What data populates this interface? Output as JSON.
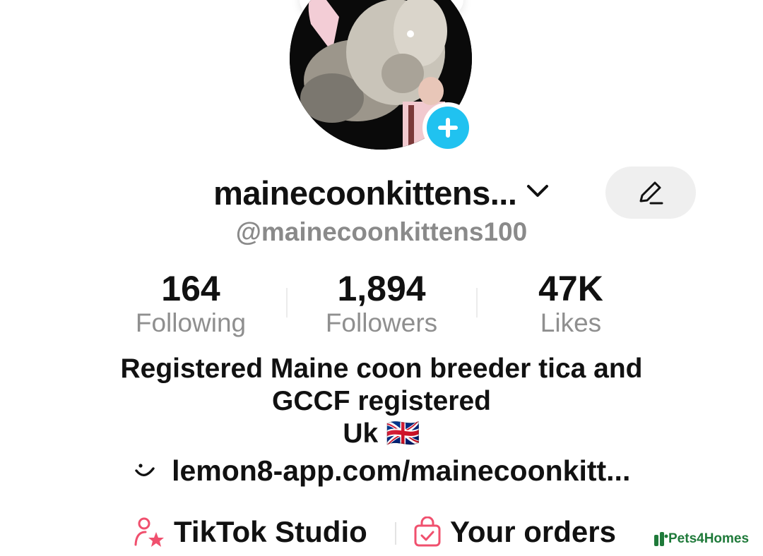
{
  "profile": {
    "display_name": "mainecoonkittens...",
    "handle": "@mainecoonkittens100"
  },
  "stats": {
    "following": {
      "value": "164",
      "label": "Following"
    },
    "followers": {
      "value": "1,894",
      "label": "Followers"
    },
    "likes": {
      "value": "47K",
      "label": "Likes"
    }
  },
  "bio": {
    "line1": "Registered Maine coon breeder tica and",
    "line2": "GCCF registered",
    "line3": "Uk 🇬🇧"
  },
  "link": {
    "text": "lemon8-app.com/mainecoonkitt..."
  },
  "actions": {
    "studio_label": "TikTok Studio",
    "orders_label": "Your orders"
  },
  "watermark": {
    "text": "Pets4Homes"
  },
  "icons": {
    "add": "plus-icon",
    "chevron": "chevron-down-icon",
    "edit": "pencil-icon",
    "link": "smile-icon",
    "studio": "person-star-icon",
    "orders": "shopping-bag-icon"
  },
  "colors": {
    "accent_blue": "#20c2f0",
    "icon_red": "#f0506e",
    "watermark_green": "#1f7a3a",
    "muted_text": "#8a8a8a"
  }
}
